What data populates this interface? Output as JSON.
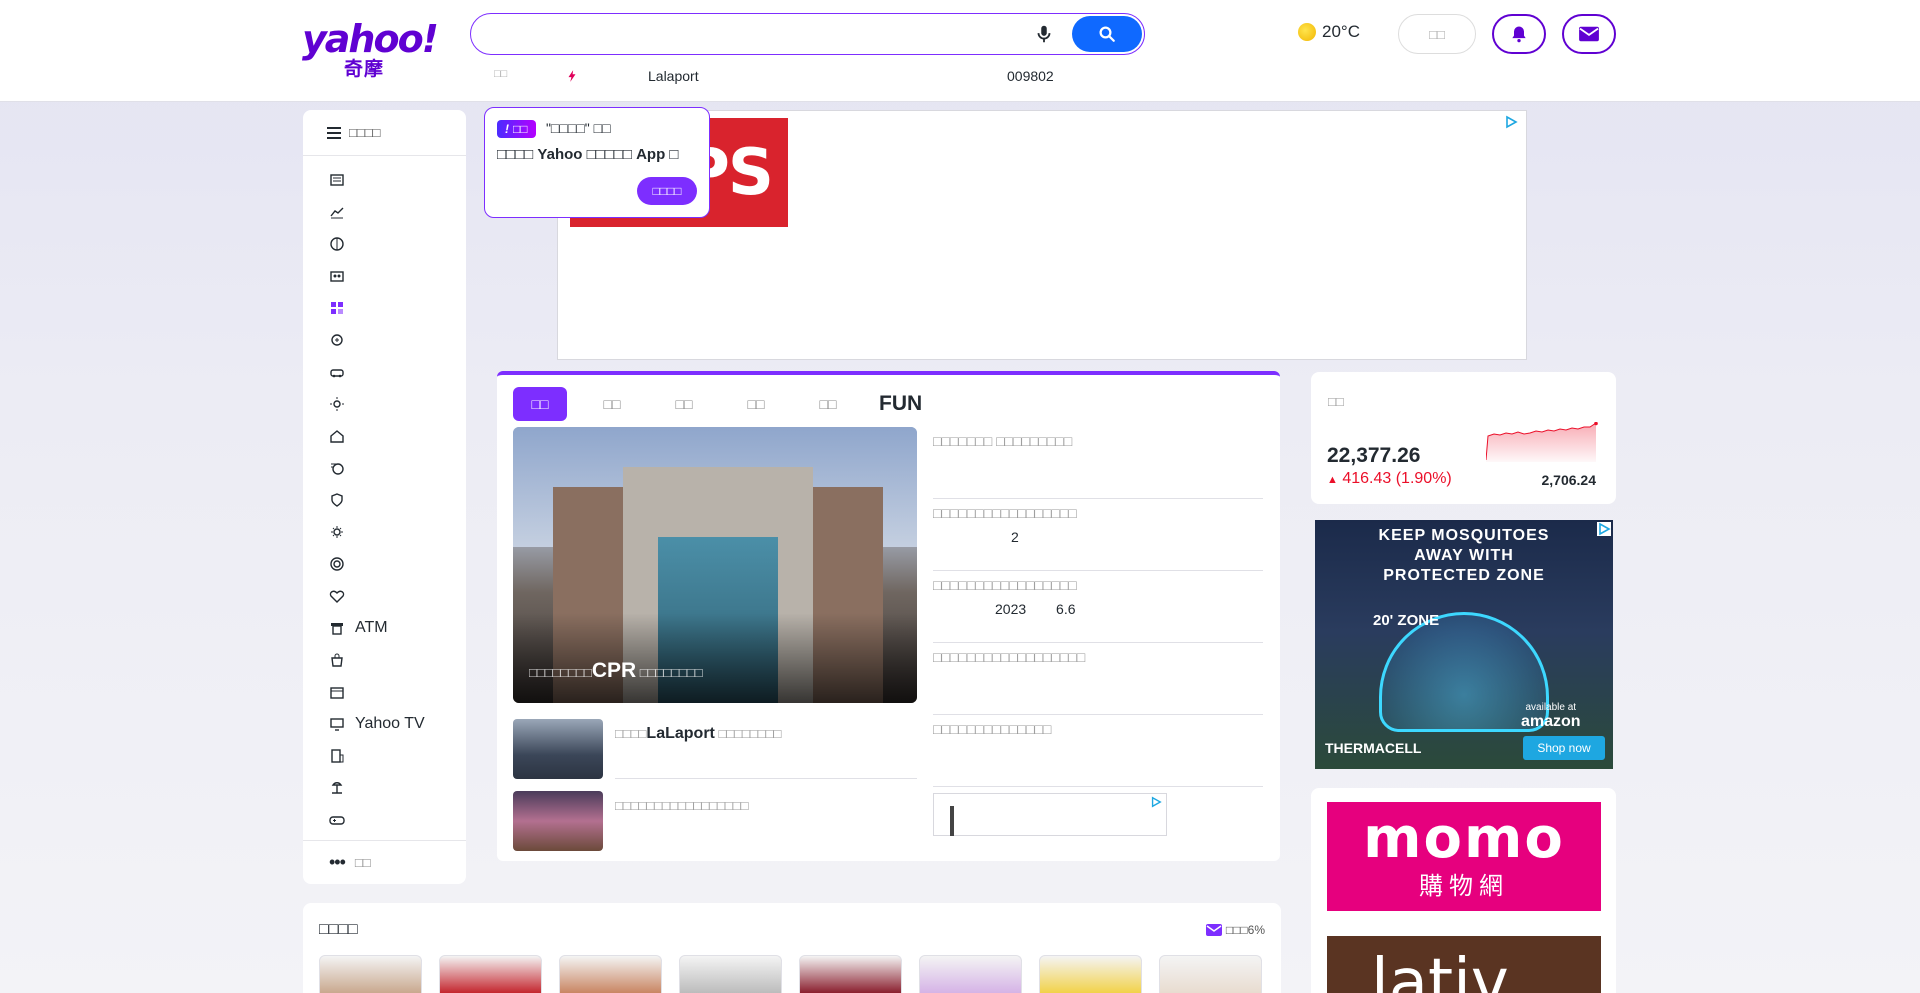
{
  "header": {
    "logo_text": "yahoo!",
    "logo_sub": "奇摩",
    "search": {
      "value": "",
      "placeholder": ""
    },
    "trending": [
      {
        "label": "□□",
        "kind": "placeholder"
      },
      {
        "label": "",
        "kind": "hot-icon"
      },
      {
        "label": "Lalaport",
        "kind": "text"
      },
      {
        "label": "009802",
        "kind": "text"
      }
    ],
    "weather": {
      "temp": "20°C",
      "icon": "sun-icon"
    },
    "login_label": "□□",
    "bell_icon": "bell-icon",
    "mail_icon": "mail-icon"
  },
  "sidebar": {
    "menu_label": "□□□□",
    "items": [
      {
        "icon": "newspaper-icon",
        "label": ""
      },
      {
        "icon": "finance-icon",
        "label": ""
      },
      {
        "icon": "sports-icon",
        "label": ""
      },
      {
        "icon": "entertainment-icon",
        "label": ""
      },
      {
        "icon": "shopping-icon",
        "label": ""
      },
      {
        "icon": "auction-icon",
        "label": ""
      },
      {
        "icon": "car-icon",
        "label": ""
      },
      {
        "icon": "weather-icon",
        "label": ""
      },
      {
        "icon": "house-icon",
        "label": ""
      },
      {
        "icon": "money-icon",
        "label": ""
      },
      {
        "icon": "shield-icon",
        "label": ""
      },
      {
        "icon": "astrology-icon",
        "label": ""
      },
      {
        "icon": "target-icon",
        "label": ""
      },
      {
        "icon": "heart-icon",
        "label": ""
      },
      {
        "icon": "atm-icon",
        "label": "ATM"
      },
      {
        "icon": "bag-icon",
        "label": ""
      },
      {
        "icon": "movie-icon",
        "label": ""
      },
      {
        "icon": "tv-icon",
        "label": "Yahoo TV"
      },
      {
        "icon": "building-icon",
        "label": ""
      },
      {
        "icon": "travel-icon",
        "label": ""
      },
      {
        "icon": "game-icon",
        "label": ""
      }
    ],
    "more_label": "□□"
  },
  "tooltip": {
    "badge": "□□",
    "line1": "\"□□□□\" □□",
    "line2_pre": "□□□□",
    "line2_brand": "Yahoo",
    "line2_mid": " □□□□□ ",
    "line2_app": "App",
    "line2_post": "□",
    "button": "□□□□"
  },
  "ad_top": {
    "logo_text": "PS"
  },
  "news": {
    "tabs": [
      "□□",
      "□□",
      "□□",
      "□□",
      "□□",
      "FUN"
    ],
    "hero": {
      "pre": "□□□□□□□□",
      "bold": "CPR",
      "post": " □□□□□□□□"
    },
    "right_items": [
      {
        "title": "□□□□□□□ □□□□□□□□□",
        "sub": ""
      },
      {
        "title": "□□□□□□□□□□□□□□□□□",
        "sub": "2"
      },
      {
        "title": "□□□□□□□□□□□□□□□□□",
        "sub": "2023",
        "sub2": "6.6"
      },
      {
        "title": "□□□□□□□□□□□□□□□□□□",
        "sub": ""
      },
      {
        "title": "□□□□□□□□□□□□□□",
        "sub": ""
      }
    ],
    "small_items": [
      {
        "pre": "□□□□",
        "bold": "LaLaport",
        "post": " □□□□□□□□"
      },
      {
        "pre": "□□□□□□□□□□□□□□□□□",
        "bold": "",
        "post": ""
      }
    ]
  },
  "stock": {
    "label": "□□",
    "value": "22,377.26",
    "change": "416.43 (1.90%)",
    "volume": "2,706.24"
  },
  "ads_side": {
    "thermacell_headline_1": "KEEP MOSQUITOES",
    "thermacell_headline_2": "AWAY WITH",
    "thermacell_headline_3": "PROTECTED ZONE",
    "thermacell_zone": "20' ZONE",
    "thermacell_brand": "THERMACELL",
    "thermacell_available": "available at",
    "thermacell_amazon": "amazon",
    "thermacell_cta": "Shop now",
    "momo_big": "momo",
    "momo_small": "購物網",
    "lativ": "lativ"
  },
  "shopping": {
    "title": "□□□□",
    "badge": "□□□6%",
    "product_colors": [
      "#c9a88e",
      "#c4262e",
      "#c98563",
      "#bcbcbc",
      "#8a1f2e",
      "#d5b3e6",
      "#f2d24a",
      "#e8dcd0"
    ]
  },
  "colors": {
    "brand": "#6001d2",
    "accent": "#7d2eff",
    "search_button": "#0f69ff",
    "down_red": "#eb0f29"
  }
}
